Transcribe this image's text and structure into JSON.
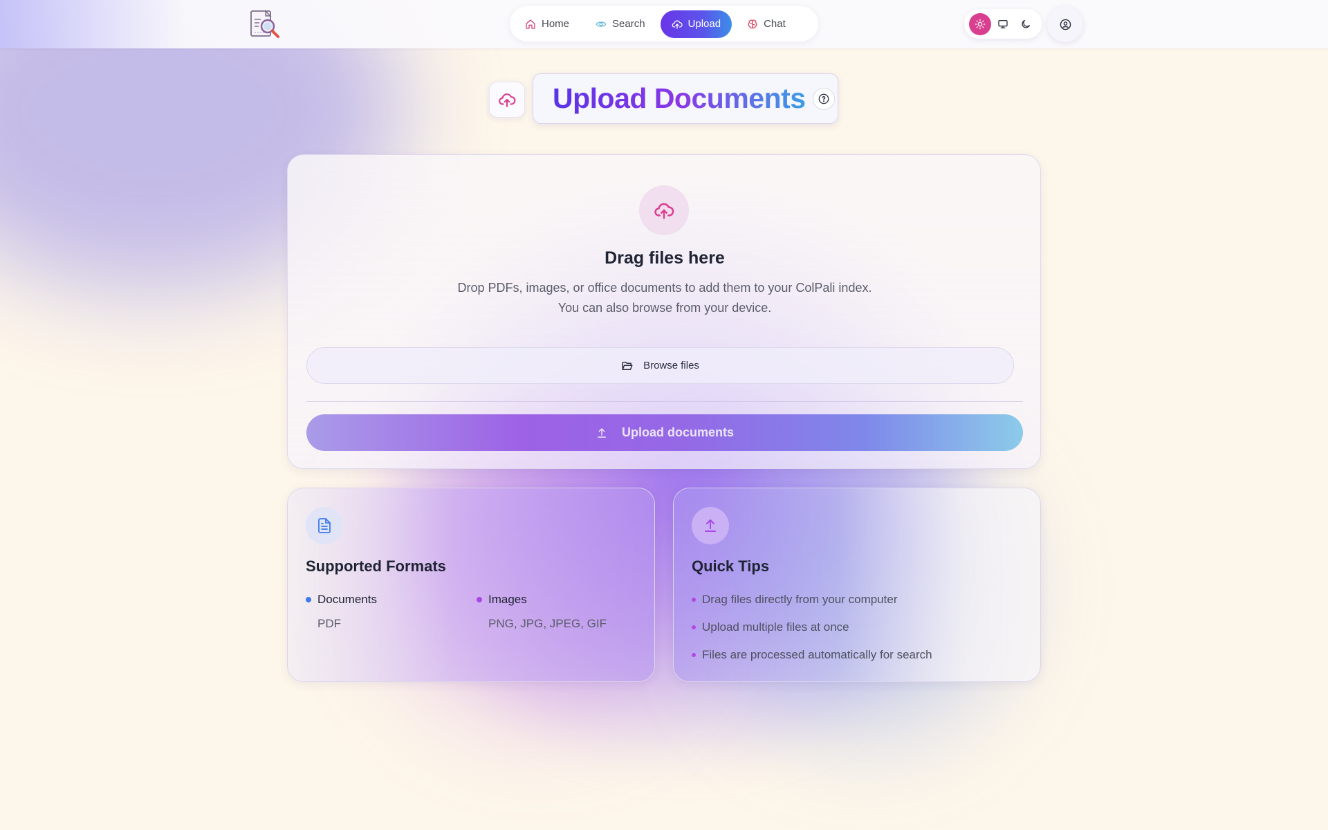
{
  "colors": {
    "accent_pink": "#d93f8f",
    "accent_purple": "#6a35e8",
    "accent_blue": "#3b8fe8",
    "bullet_blue": "#3b7be8",
    "bullet_purple": "#a946e8",
    "background": "#fdf6ea"
  },
  "topbar": {
    "logo_icon": "document-search-logo",
    "nav": [
      {
        "label": "Home",
        "icon": "home-icon",
        "active": false
      },
      {
        "label": "Search",
        "icon": "eye-icon",
        "active": false
      },
      {
        "label": "Upload",
        "icon": "cloud-upload-icon",
        "active": true
      },
      {
        "label": "Chat",
        "icon": "brain-icon",
        "active": false
      }
    ],
    "theme_options": [
      {
        "icon": "sun-icon",
        "active": true
      },
      {
        "icon": "monitor-icon",
        "active": false
      },
      {
        "icon": "moon-icon",
        "active": false
      }
    ],
    "profile_icon": "user-circle-icon"
  },
  "header": {
    "icon": "cloud-upload-icon",
    "title": "Upload Documents",
    "help_icon": "question-circle-icon"
  },
  "dropzone": {
    "icon": "cloud-upload-icon",
    "title": "Drag files here",
    "description": "Drop PDFs, images, or office documents to add them to your ColPali index. You can also browse from your device.",
    "browse_label": "Browse files",
    "browse_icon": "folder-open-icon",
    "upload_label": "Upload documents",
    "upload_icon": "upload-arrow-icon"
  },
  "formats": {
    "icon": "file-text-icon",
    "title": "Supported Formats",
    "groups": [
      {
        "name": "Documents",
        "types": "PDF"
      },
      {
        "name": "Images",
        "types": "PNG, JPG, JPEG, GIF"
      }
    ]
  },
  "tips": {
    "icon": "upload-arrow-icon",
    "title": "Quick Tips",
    "items": [
      "Drag files directly from your computer",
      "Upload multiple files at once",
      "Files are processed automatically for search"
    ]
  }
}
